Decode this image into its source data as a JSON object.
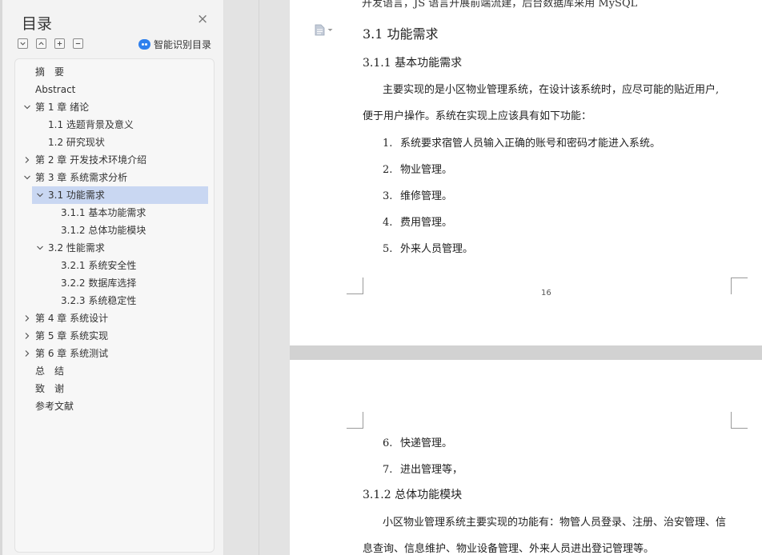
{
  "sidebar": {
    "title": "目录",
    "close_icon": "×",
    "tools": [
      "collapse-all-icon",
      "expand-up-icon",
      "plus-icon",
      "minus-icon"
    ],
    "smart_label": "智能识别目录",
    "items": [
      {
        "label": "摘　要",
        "expander": "none"
      },
      {
        "label": "Abstract",
        "expander": "none"
      },
      {
        "label": "第 1 章  绪论",
        "expander": "down"
      },
      {
        "label": "1.1  选题背景及意义",
        "expander": "none"
      },
      {
        "label": "1.2 研究现状",
        "expander": "none"
      },
      {
        "label": "第 2 章  开发技术环境介绍",
        "expander": "right"
      },
      {
        "label": "第 3 章  系统需求分析",
        "expander": "down"
      },
      {
        "label": "3.1 功能需求",
        "expander": "down",
        "selected": true
      },
      {
        "label": "3.1.1  基本功能需求",
        "expander": "none"
      },
      {
        "label": "3.1.2  总体功能模块",
        "expander": "none"
      },
      {
        "label": "3.2 性能需求",
        "expander": "down"
      },
      {
        "label": "3.2.1 系统安全性",
        "expander": "none"
      },
      {
        "label": "3.2.2  数据库选择",
        "expander": "none"
      },
      {
        "label": "3.2.3 系统稳定性",
        "expander": "none"
      },
      {
        "label": "第 4 章  系统设计",
        "expander": "right"
      },
      {
        "label": "第 5 章  系统实现",
        "expander": "right"
      },
      {
        "label": "第 6 章  系统测试",
        "expander": "right"
      },
      {
        "label": "总　结",
        "expander": "none"
      },
      {
        "label": "致　谢",
        "expander": "none"
      },
      {
        "label": "参考文献",
        "expander": "none"
      }
    ]
  },
  "document": {
    "cut_top_text": "开发语言，JS 语言开展前端流建，后台数据库采用 MySQL",
    "section_heading": "3.1 功能需求",
    "sub_heading_1": "3.1.1  基本功能需求",
    "intro_line_1": "主要实现的是小区物业管理系统，在设计该系统时，应尽可能的贴近用户,",
    "intro_line_2": "便于用户操作。系统在实现上应该具有如下功能：",
    "list_page1": [
      {
        "num": "1.",
        "text": "系统要求宿管人员输入正确的账号和密码才能进入系统。"
      },
      {
        "num": "2.",
        "text": "物业管理。"
      },
      {
        "num": "3.",
        "text": "维修管理。"
      },
      {
        "num": "4.",
        "text": "费用管理。"
      },
      {
        "num": "5.",
        "text": "外来人员管理。"
      }
    ],
    "page_number": "16",
    "list_page2": [
      {
        "num": "6.",
        "text": "快递管理。"
      },
      {
        "num": "7.",
        "text": "进出管理等，"
      }
    ],
    "sub_heading_2": "3.1.2  总体功能模块",
    "module_line_1": "小区物业管理系统主要实现的功能有：物管人员登录、注册、治安管理、信",
    "module_line_2": "息查询、信息维护、物业设备管理、外来人员进出登记管理等。"
  }
}
